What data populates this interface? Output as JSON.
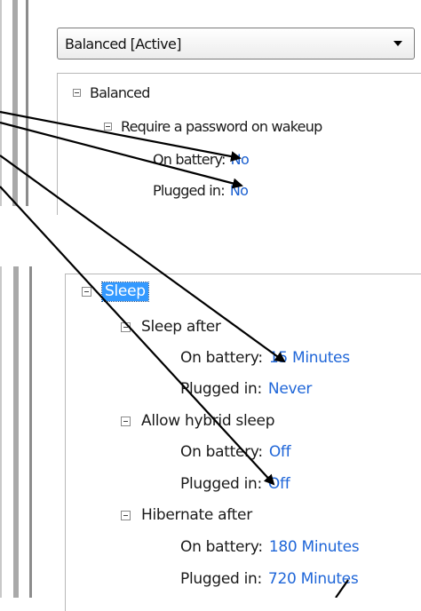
{
  "top": {
    "plan_dropdown": {
      "value": "Balanced [Active]"
    },
    "tree": {
      "root_label": "Balanced",
      "setting_label": "Require a password on wakeup",
      "on_battery_label": "On battery:",
      "on_battery_value": "No",
      "plugged_in_label": "Plugged in:",
      "plugged_in_value": "No"
    }
  },
  "bottom": {
    "tree": {
      "root_label": "Sleep",
      "sleep_after": {
        "label": "Sleep after",
        "on_battery_label": "On battery:",
        "on_battery_value": "15 Minutes",
        "plugged_in_label": "Plugged in:",
        "plugged_in_value": "Never"
      },
      "hybrid_sleep": {
        "label": "Allow hybrid sleep",
        "on_battery_label": "On battery:",
        "on_battery_value": "Off",
        "plugged_in_label": "Plugged in:",
        "plugged_in_value": "Off"
      },
      "hibernate_after": {
        "label": "Hibernate after",
        "on_battery_label": "On battery:",
        "on_battery_value": "180 Minutes",
        "plugged_in_label": "Plugged in:",
        "plugged_in_value": "720 Minutes"
      }
    }
  },
  "colors": {
    "value_text": "#1f66d8",
    "selection": "#3399ff",
    "annotation_arrow": "#000000"
  }
}
